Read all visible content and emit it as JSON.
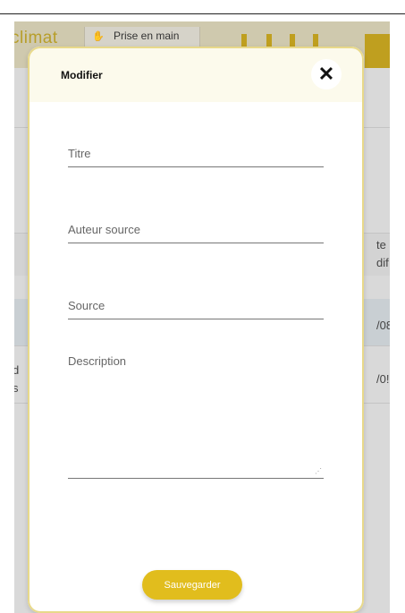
{
  "background": {
    "tab_left_text": "climat",
    "tab_label": "Prise en main",
    "row_texts_right": [
      "te",
      "dif",
      "/08",
      "/0!"
    ],
    "row_texts_left": [
      "d",
      "s"
    ]
  },
  "modal": {
    "title": "Modifier",
    "close_symbol": "✕",
    "fields": {
      "title_label": "Titre",
      "author_label": "Auteur source",
      "source_label": "Source",
      "description_label": "Description"
    },
    "save_label": "Sauvegarder"
  },
  "colors": {
    "accent": "#e1bd1d",
    "header_bg": "#fcfaec",
    "overlay": "#d9d9d9"
  },
  "icons": [
    "hand-icon",
    "close-icon",
    "resize-grip-icon"
  ]
}
